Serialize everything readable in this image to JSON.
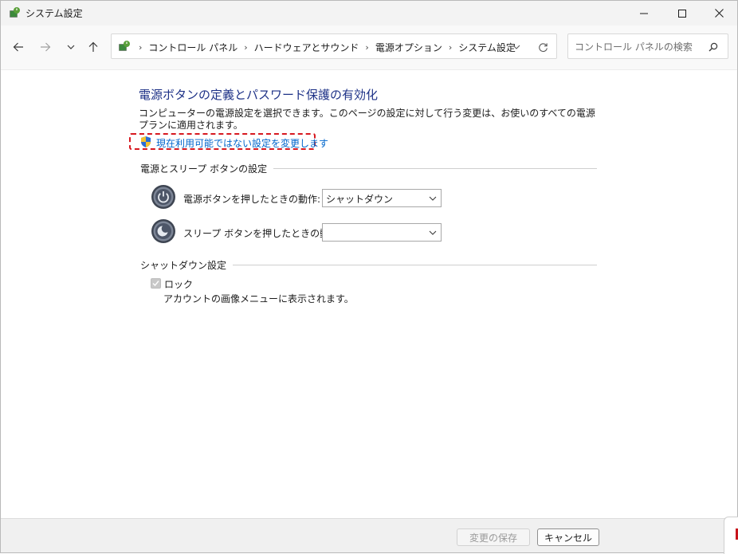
{
  "window": {
    "title": "システム設定",
    "controls": [
      "minimize",
      "maximize",
      "close"
    ]
  },
  "nav": {
    "breadcrumbs": [
      "コントロール パネル",
      "ハードウェアとサウンド",
      "電源オプション",
      "システム設定"
    ],
    "search_placeholder": "コントロール パネルの検索"
  },
  "main": {
    "title": "電源ボタンの定義とパスワード保護の有効化",
    "description": "コンピューターの電源設定を選択できます。このページの設定に対して行う変更は、お使いのすべての電源プランに適用されます。",
    "change_link": "現在利用可能ではない設定を変更します",
    "power_section": {
      "label": "電源とスリープ ボタンの設定",
      "rows": [
        {
          "label": "電源ボタンを押したときの動作:",
          "value": "シャットダウン"
        },
        {
          "label": "スリープ ボタンを押したときの動作:",
          "value": ""
        }
      ]
    },
    "shutdown_section": {
      "label": "シャットダウン設定",
      "lock": {
        "label": "ロック",
        "description": "アカウントの画像メニューに表示されます。",
        "checked": true,
        "disabled": true
      }
    }
  },
  "footer": {
    "save_label": "変更の保存",
    "cancel_label": "キャンセル"
  },
  "colors": {
    "title_blue": "#1e3287",
    "link_blue": "#0066cc",
    "highlight_red": "#d71920"
  }
}
